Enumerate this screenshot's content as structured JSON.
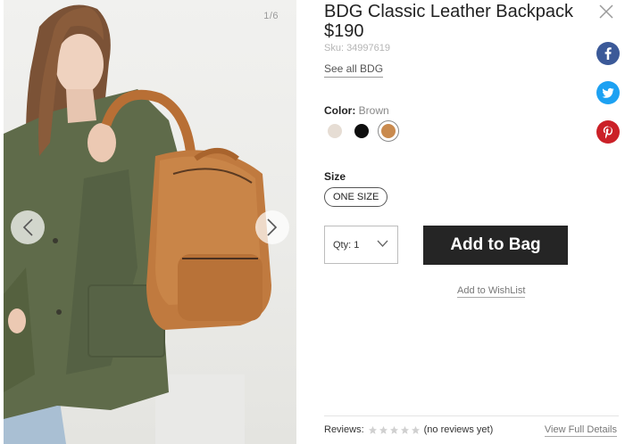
{
  "gallery": {
    "counter": "1/6"
  },
  "product": {
    "title": "BDG Classic Leather Backpack",
    "price": "$190",
    "sku": "Sku: 34997619",
    "see_all": "See all BDG"
  },
  "color": {
    "label": "Color:",
    "selected": "Brown",
    "swatches": [
      {
        "name": "cream",
        "hex": "#e6ddd4"
      },
      {
        "name": "black",
        "hex": "#0e0e0e"
      },
      {
        "name": "brown",
        "hex": "#c98a4e",
        "selected": true
      }
    ]
  },
  "size": {
    "label": "Size",
    "option": "ONE SIZE"
  },
  "quantity": {
    "label": "Qty: 1"
  },
  "actions": {
    "add_to_bag": "Add to Bag",
    "wishlist": "Add to WishList"
  },
  "reviews": {
    "label": "Reviews:",
    "rating": 0,
    "status": "(no reviews yet)",
    "full_details": "View Full Details"
  },
  "colors": {
    "facebook": "#3b5998",
    "twitter": "#1da1f2",
    "pinterest": "#cb2027",
    "add_button": "#252525"
  }
}
